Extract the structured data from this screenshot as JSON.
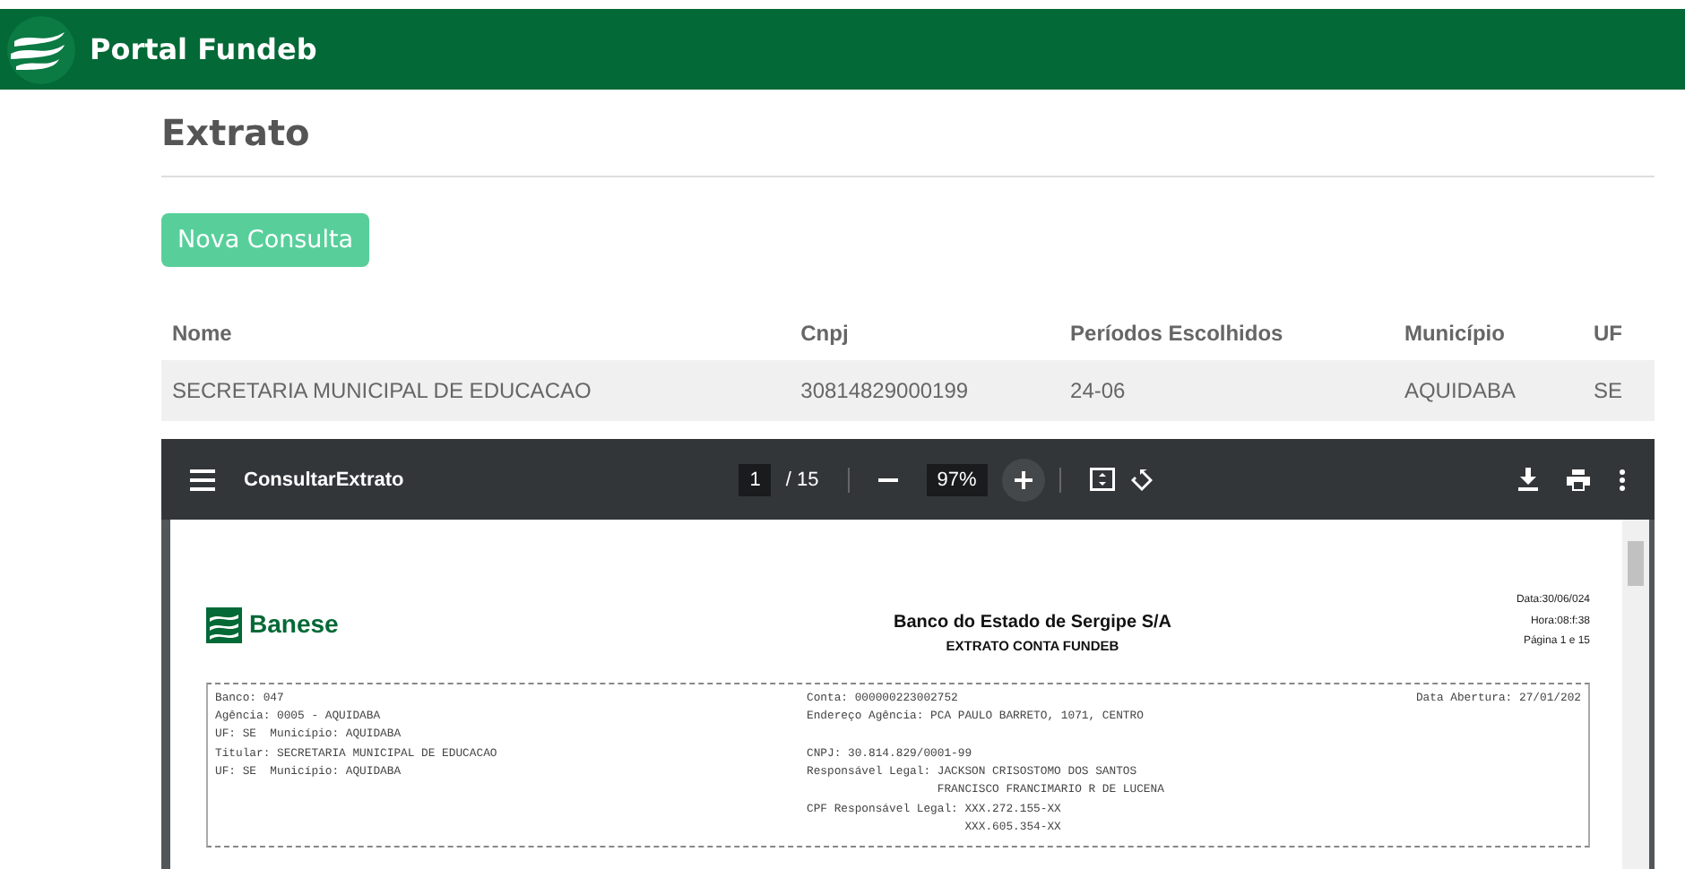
{
  "navbar": {
    "brand": "Portal Fundeb"
  },
  "page": {
    "title": "Extrato",
    "button": "Nova Consulta"
  },
  "table": {
    "columns": [
      "Nome",
      "Cnpj",
      "Períodos Escolhidos",
      "Município",
      "UF"
    ],
    "rows": [
      [
        "SECRETARIA MUNICIPAL DE EDUCACAO",
        "30814829000199",
        "24-06",
        "AQUIDABA",
        "SE"
      ]
    ]
  },
  "pdf_viewer": {
    "title": "ConsultarExtrato",
    "page": "1",
    "page_count": "/ 15",
    "zoom": "97%",
    "document": {
      "logo": "Banese",
      "heading": "Banco do Estado de Sergipe S/A",
      "subheading": "EXTRATO CONTA FUNDEB",
      "meta": [
        "Data:30/06/024",
        "Hora:08:f:38",
        "Página 1 e 15"
      ],
      "rows": [
        {
          "left": "Banco: 047",
          "right": "Conta: 000000223002752",
          "far": "Data Abertura: 27/01/202"
        },
        {
          "left": "Agência: 0005 - AQUIDABA",
          "right": "Endereço Agência: PCA PAULO BARRETO, 1071, CENTRO"
        },
        {
          "left": "UF: SE  Município: AQUIDABA"
        },
        {
          "left": "Titular: SECRETARIA MUNICIPAL DE EDUCACAO",
          "right": "CNPJ: 30.814.829/0001-99"
        },
        {
          "left": "UF: SE  Município: AQUIDABA",
          "right": "Responsável Legal: JACKSON CRISOSTOMO DOS SANTOS"
        },
        {
          "right": "                   FRANCISCO FRANCIMARIO R DE LUCENA"
        },
        {
          "right": "CPF Responsável Legal: XXX.272.155-XX"
        },
        {
          "right": "                       XXX.605.354-XX"
        }
      ]
    }
  }
}
